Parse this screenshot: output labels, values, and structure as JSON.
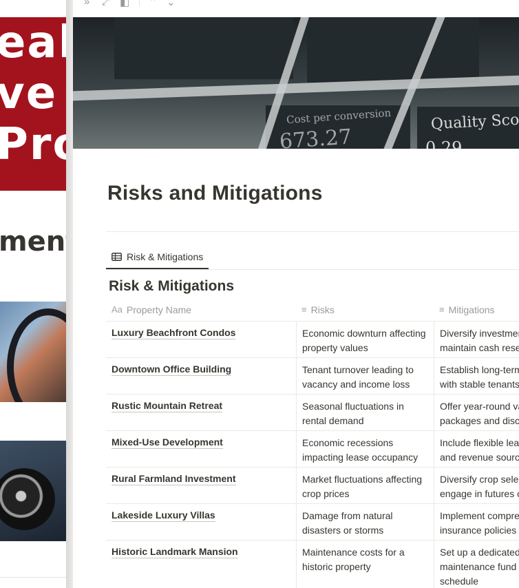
{
  "background_page": {
    "banner_text": "eal\nve\nPro",
    "heading": "ment"
  },
  "toolbar": {
    "icons": [
      "double-chevron-right-icon",
      "expand-icon",
      "side-peek-icon",
      "chevron-up-icon",
      "chevron-down-icon"
    ]
  },
  "cover": {
    "text_a": "Cost per conversion",
    "text_b": "673.27",
    "text_c": "Quality Sco",
    "text_d": "0.29"
  },
  "page": {
    "title": "Risks and Mitigations"
  },
  "view_tab": {
    "label": "Risk & Mitigations",
    "icon": "table-icon"
  },
  "database": {
    "title": "Risk & Mitigations",
    "columns": [
      {
        "label": "Property Name",
        "icon": "Aa"
      },
      {
        "label": "Risks",
        "icon": "≡"
      },
      {
        "label": "Mitigations",
        "icon": "≡"
      }
    ],
    "rows": [
      {
        "name": "Luxury Beachfront Condos",
        "risk": [
          "Economic downturn affecting",
          "property values"
        ],
        "mitigation": [
          "Diversify investmen",
          "maintain cash reser"
        ]
      },
      {
        "name": "Downtown Office Building",
        "risk": [
          "Tenant turnover leading to",
          "vacancy and income loss"
        ],
        "mitigation": [
          "Establish long-term",
          "with stable tenants"
        ]
      },
      {
        "name": "Rustic Mountain Retreat",
        "risk": [
          "Seasonal fluctuations in",
          "rental demand"
        ],
        "mitigation": [
          "Offer year-round va",
          "packages and disco"
        ]
      },
      {
        "name": "Mixed-Use Development",
        "risk": [
          "Economic recessions",
          "impacting lease occupancy"
        ],
        "mitigation": [
          "Include flexible leas",
          "and revenue source"
        ]
      },
      {
        "name": "Rural Farmland Investment",
        "risk": [
          "Market fluctuations affecting",
          "crop prices"
        ],
        "mitigation": [
          "Diversify crop selec",
          "engage in futures c"
        ]
      },
      {
        "name": "Lakeside Luxury Villas",
        "risk": [
          "Damage from natural",
          "disasters or storms"
        ],
        "mitigation": [
          "Implement compre",
          "insurance policies"
        ]
      },
      {
        "name": "Historic Landmark Mansion",
        "risk": [
          "Maintenance costs for a",
          "historic property"
        ],
        "mitigation": [
          "Set up a dedicated",
          "maintenance fund",
          "schedule"
        ]
      }
    ]
  }
}
